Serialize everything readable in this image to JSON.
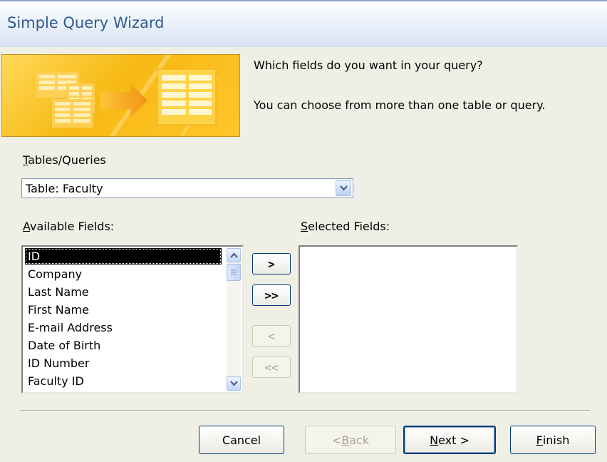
{
  "window": {
    "title": "Simple Query Wizard"
  },
  "header": {
    "question": "Which fields do you want in your query?",
    "hint": "You can choose from more than one table or query."
  },
  "tables": {
    "label_accel": "T",
    "label_rest": "ables/Queries",
    "selected": "Table: Faculty"
  },
  "available": {
    "label_accel": "A",
    "label_rest": "vailable Fields:",
    "items": [
      "ID",
      "Company",
      "Last Name",
      "First Name",
      "E-mail Address",
      "Date of Birth",
      "ID Number",
      "Faculty ID"
    ],
    "selected_index": 0
  },
  "selected_fields": {
    "label_accel": "S",
    "label_rest": "elected Fields:",
    "items": []
  },
  "move_buttons": {
    "add_one": ">",
    "add_all": ">>",
    "remove_one": "<",
    "remove_all": "<<"
  },
  "footer": {
    "cancel": "Cancel",
    "back_prefix": "< ",
    "back_accel": "B",
    "back_rest": "ack",
    "next_accel": "N",
    "next_rest": "ext >",
    "finish_accel": "F",
    "finish_rest": "inish"
  }
}
